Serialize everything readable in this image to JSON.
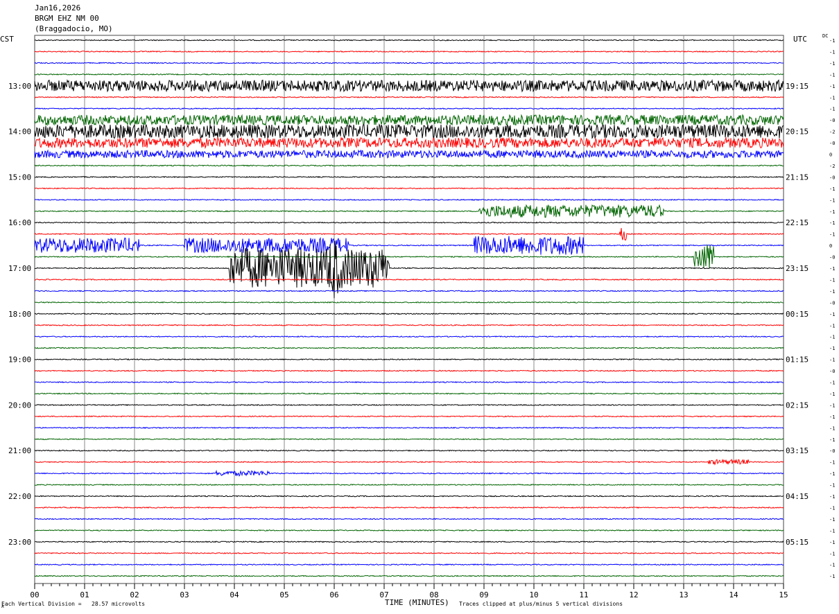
{
  "header": {
    "date": "Jan16,2026",
    "station": "BRGM EHZ NM 00",
    "location": "(Braggadocio, MO)"
  },
  "left_timezone": "CST",
  "right_timezone": "UTC",
  "dc_label": "DC",
  "footer": {
    "left": "Each Vertical Division =   28.57 microvolts",
    "right": "Traces clipped at plus/minus 5 vertical divisions",
    "mark": "A"
  },
  "chart_data": {
    "type": "line",
    "title": "",
    "xlabel": "TIME (MINUTES)",
    "ylabel": "",
    "xlim": [
      0,
      15
    ],
    "x_ticks": [
      "00",
      "01",
      "02",
      "03",
      "04",
      "05",
      "06",
      "07",
      "08",
      "09",
      "10",
      "11",
      "12",
      "13",
      "14",
      "15"
    ],
    "left_hour_labels": [
      "13:00",
      "14:00",
      "15:00",
      "16:00",
      "17:00",
      "18:00",
      "19:00",
      "20:00",
      "21:00",
      "22:00",
      "23:00"
    ],
    "right_hour_labels": [
      "19:15",
      "20:15",
      "21:15",
      "22:15",
      "23:15",
      "00:15",
      "01:15",
      "02:15",
      "03:15",
      "04:15",
      "05:15"
    ],
    "trace_minutes": 15,
    "trace_count": 48,
    "trace_colors": [
      "#000000",
      "#ff0000",
      "#0000ff",
      "#006400"
    ],
    "dc_offsets": [
      "-1",
      "-1",
      "-1",
      "-1",
      "-1",
      "-1",
      "-1",
      "-0",
      "-2",
      "-0",
      "0",
      "-2",
      "-0",
      "-1",
      "-1",
      "-1",
      "-1",
      "-1",
      "0",
      "-0",
      "-1",
      "-1",
      "-1",
      "-0",
      "-1",
      "-1",
      "-1",
      "-1",
      "-1",
      "-0",
      "-1",
      "-1",
      "-1",
      "-1",
      "-1",
      "-1",
      "-0",
      "-1",
      "-1",
      "-1",
      "-1",
      "-1",
      "-1",
      "-1",
      "-1",
      "-1",
      "-1",
      "-1"
    ],
    "events": [
      {
        "trace": 4,
        "start_min": 0.0,
        "end_min": 15.0,
        "amplitude_div": 0.9
      },
      {
        "trace": 7,
        "start_min": 0.0,
        "end_min": 15.0,
        "amplitude_div": 0.8
      },
      {
        "trace": 8,
        "start_min": 0.0,
        "end_min": 15.0,
        "amplitude_div": 1.1
      },
      {
        "trace": 9,
        "start_min": 0.0,
        "end_min": 15.0,
        "amplitude_div": 0.8
      },
      {
        "trace": 10,
        "start_min": 0.0,
        "end_min": 15.0,
        "amplitude_div": 0.6
      },
      {
        "trace": 15,
        "start_min": 8.9,
        "end_min": 12.6,
        "amplitude_div": 1.0
      },
      {
        "trace": 17,
        "start_min": 11.7,
        "end_min": 11.85,
        "amplitude_div": 1.0
      },
      {
        "trace": 18,
        "start_min": 0.0,
        "end_min": 2.1,
        "amplitude_div": 1.2
      },
      {
        "trace": 18,
        "start_min": 3.0,
        "end_min": 6.3,
        "amplitude_div": 1.2
      },
      {
        "trace": 18,
        "start_min": 8.8,
        "end_min": 11.0,
        "amplitude_div": 1.5
      },
      {
        "trace": 19,
        "start_min": 13.2,
        "end_min": 13.6,
        "amplitude_div": 2.2
      },
      {
        "trace": 20,
        "start_min": 3.9,
        "end_min": 7.1,
        "amplitude_div": 3.2
      },
      {
        "trace": 20,
        "start_min": 5.9,
        "end_min": 6.1,
        "amplitude_div": 5.0
      },
      {
        "trace": 37,
        "start_min": 13.5,
        "end_min": 14.3,
        "amplitude_div": 0.4
      },
      {
        "trace": 38,
        "start_min": 3.6,
        "end_min": 4.7,
        "amplitude_div": 0.4
      }
    ]
  }
}
